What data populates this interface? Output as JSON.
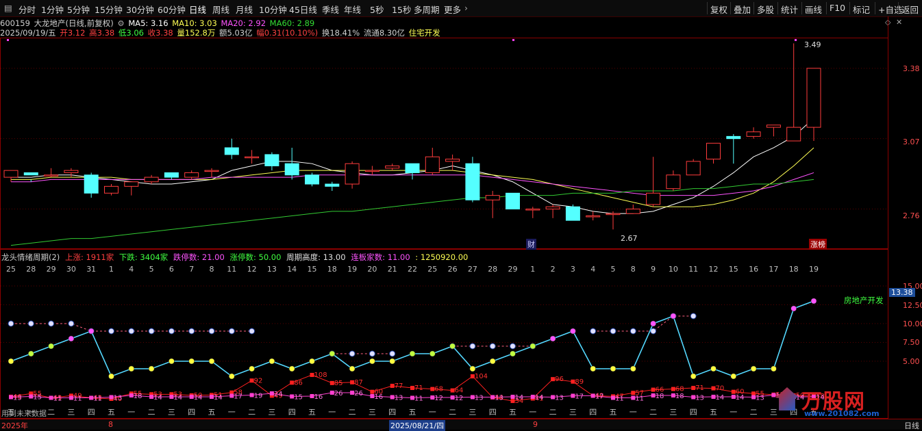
{
  "toolbar": {
    "left_items": [
      "分时",
      "1分钟",
      "5分钟",
      "15分钟",
      "30分钟",
      "60分钟",
      "日线",
      "周线",
      "月线",
      "10分钟",
      "45日线",
      "季线",
      "年线",
      "5秒",
      "15秒",
      "多周期",
      "更多"
    ],
    "active_item": "日线",
    "right_items": [
      "复权",
      "叠加",
      "多股",
      "统计",
      "画线",
      "F10",
      "标记",
      "+自选",
      "返回"
    ]
  },
  "stock": {
    "line1_code": "600159",
    "line1_name": "大龙地产(日线,前复权)",
    "ma5": "MA5: 3.16",
    "ma10": "MA10: 3.03",
    "ma20": "MA20: 2.92",
    "ma60": "MA60: 2.89",
    "date": "2025/09/19/五",
    "open": "开3.12",
    "high": "高3.38",
    "low": "低3.06",
    "close": "收3.38",
    "volume": "量152.8万",
    "amount": "额5.03亿",
    "change": "幅0.31(10.10%)",
    "turnover": "换18.41%",
    "float": "流通8.30亿",
    "sector": "住宅开发"
  },
  "price_axis": [
    "3.38",
    "3.07",
    "2.76"
  ],
  "price_annotations": {
    "high": "3.49",
    "low": "2.67",
    "tag_cai": "财",
    "tag_zhangbang": "涨榜"
  },
  "colors": {
    "up": "#ff3c3c",
    "down": "#54ffff",
    "ma5": "#ffffff",
    "ma10": "#ffff54",
    "ma20": "#ff54ff",
    "ma60": "#33cc33",
    "bg": "#000000",
    "grid": "#8b0000"
  },
  "chart_data": {
    "type": "candlestick",
    "candles": [
      [
        2.9,
        2.93,
        2.88,
        2.92
      ],
      [
        2.92,
        2.91,
        2.89,
        2.88
      ],
      [
        2.91,
        2.91,
        2.94,
        2.9
      ],
      [
        2.92,
        2.93,
        2.94,
        2.9
      ],
      [
        2.91,
        2.83,
        2.92,
        2.81
      ],
      [
        2.83,
        2.86,
        2.87,
        2.82
      ],
      [
        2.86,
        2.88,
        2.88,
        2.82
      ],
      [
        2.88,
        2.9,
        2.91,
        2.87
      ],
      [
        2.92,
        2.9,
        2.92,
        2.89
      ],
      [
        2.9,
        2.92,
        2.93,
        2.89
      ],
      [
        2.93,
        2.93,
        2.94,
        2.9
      ],
      [
        3.03,
        3.0,
        3.07,
        2.98
      ],
      [
        2.99,
        2.99,
        3.02,
        2.96
      ],
      [
        3.0,
        2.95,
        3.01,
        2.93
      ],
      [
        2.96,
        2.91,
        3.03,
        2.89
      ],
      [
        2.91,
        2.87,
        2.92,
        2.86
      ],
      [
        2.87,
        2.86,
        2.88,
        2.84
      ],
      [
        2.87,
        2.96,
        2.97,
        2.85
      ],
      [
        2.93,
        2.93,
        2.95,
        2.91
      ],
      [
        2.94,
        2.95,
        2.96,
        2.93
      ],
      [
        2.96,
        2.92,
        2.96,
        2.89
      ],
      [
        2.92,
        2.99,
        3.03,
        2.91
      ],
      [
        2.97,
        2.98,
        3.0,
        2.93
      ],
      [
        2.96,
        2.8,
        2.99,
        2.79
      ],
      [
        2.8,
        2.82,
        2.84,
        2.72
      ],
      [
        2.83,
        2.76,
        2.83,
        2.76
      ],
      [
        2.76,
        2.76,
        2.77,
        2.72
      ],
      [
        2.76,
        2.77,
        2.78,
        2.72
      ],
      [
        2.77,
        2.71,
        2.78,
        2.71
      ],
      [
        2.73,
        2.73,
        2.75,
        2.71
      ],
      [
        2.74,
        2.74,
        2.75,
        2.67
      ],
      [
        2.74,
        2.76,
        2.78,
        2.74
      ],
      [
        2.78,
        2.83,
        2.99,
        2.77
      ],
      [
        2.85,
        2.91,
        2.93,
        2.84
      ],
      [
        2.91,
        2.97,
        2.98,
        2.91
      ],
      [
        2.98,
        3.05,
        3.05,
        2.96
      ],
      [
        3.08,
        3.07,
        3.09,
        2.96
      ],
      [
        3.08,
        3.1,
        3.12,
        3.07
      ],
      [
        3.12,
        3.13,
        3.13,
        3.08
      ],
      [
        3.06,
        3.12,
        3.49,
        3.06
      ],
      [
        3.12,
        3.38,
        3.38,
        3.06
      ]
    ],
    "ma_series": [
      {
        "name": "MA5",
        "values": [
          2.9,
          2.9,
          2.91,
          2.91,
          2.9,
          2.89,
          2.88,
          2.87,
          2.87,
          2.88,
          2.89,
          2.93,
          2.95,
          2.97,
          2.97,
          2.96,
          2.93,
          2.92,
          2.91,
          2.91,
          2.92,
          2.93,
          2.95,
          2.93,
          2.91,
          2.88,
          2.83,
          2.78,
          2.77,
          2.75,
          2.74,
          2.74,
          2.75,
          2.78,
          2.81,
          2.86,
          2.92,
          2.99,
          3.03,
          3.08,
          3.16
        ]
      },
      {
        "name": "MA10",
        "values": [
          2.89,
          2.89,
          2.9,
          2.9,
          2.9,
          2.9,
          2.89,
          2.89,
          2.89,
          2.89,
          2.89,
          2.9,
          2.91,
          2.92,
          2.93,
          2.93,
          2.93,
          2.93,
          2.93,
          2.93,
          2.93,
          2.93,
          2.93,
          2.92,
          2.91,
          2.9,
          2.89,
          2.87,
          2.85,
          2.83,
          2.81,
          2.79,
          2.77,
          2.77,
          2.77,
          2.78,
          2.8,
          2.83,
          2.88,
          2.95,
          3.03
        ]
      },
      {
        "name": "MA20",
        "values": [
          2.88,
          2.88,
          2.89,
          2.89,
          2.89,
          2.89,
          2.89,
          2.89,
          2.89,
          2.89,
          2.9,
          2.9,
          2.9,
          2.9,
          2.9,
          2.91,
          2.91,
          2.91,
          2.91,
          2.91,
          2.91,
          2.91,
          2.91,
          2.91,
          2.9,
          2.89,
          2.88,
          2.87,
          2.86,
          2.85,
          2.84,
          2.83,
          2.82,
          2.82,
          2.82,
          2.82,
          2.83,
          2.84,
          2.86,
          2.89,
          2.92
        ]
      },
      {
        "name": "MA60",
        "values": [
          2.6,
          2.61,
          2.62,
          2.63,
          2.63,
          2.64,
          2.65,
          2.66,
          2.67,
          2.68,
          2.69,
          2.7,
          2.71,
          2.72,
          2.73,
          2.74,
          2.75,
          2.75,
          2.76,
          2.77,
          2.78,
          2.79,
          2.8,
          2.81,
          2.81,
          2.82,
          2.82,
          2.82,
          2.83,
          2.83,
          2.83,
          2.84,
          2.84,
          2.84,
          2.85,
          2.85,
          2.86,
          2.87,
          2.87,
          2.88,
          2.89
        ]
      }
    ],
    "ylim": [
      2.62,
      3.5
    ]
  },
  "indicator": {
    "title": "龙头情绪周期(2)",
    "up": "上涨: 1911家",
    "down": "下跌: 3404家",
    "limit_down": "跌停数: 21.00",
    "limit_up": "涨停数: 50.00",
    "cycle_height": "周期高度: 13.00",
    "consec": "连板家数: 11.00",
    "extra": ": 1250920.00",
    "axis": [
      "15.00",
      "12.50",
      "10.00",
      "7.50",
      "5.00"
    ],
    "current_value": "13.38",
    "sector_label": "房地产开发",
    "top_labels": [
      "25",
      "28",
      "29",
      "30",
      "31",
      "1",
      "4",
      "5",
      "6",
      "7",
      "8",
      "11",
      "12",
      "13",
      "14",
      "15",
      "18",
      "19",
      "20",
      "21",
      "22",
      "25",
      "26",
      "27",
      "28",
      "29",
      "1",
      "2",
      "3",
      "4",
      "5",
      "8",
      "9",
      "10",
      "11",
      "12",
      "15",
      "16",
      "17",
      "18",
      "19"
    ],
    "bottom_labels": [
      "五",
      "一",
      "二",
      "三",
      "四",
      "五",
      "一",
      "二",
      "三",
      "四",
      "五",
      "一",
      "二",
      "三",
      "四",
      "五",
      "一",
      "二",
      "三",
      "四",
      "五",
      "一",
      "二",
      "三",
      "四",
      "五",
      "一",
      "二",
      "三",
      "四",
      "五",
      "一",
      "二",
      "三",
      "四",
      "五",
      "一",
      "二",
      "三",
      "四",
      "五"
    ],
    "cycle_values": [
      5,
      6,
      7,
      8,
      9,
      3,
      4,
      4,
      5,
      5,
      5,
      3,
      4,
      5,
      4,
      5,
      6,
      4,
      5,
      5,
      6,
      6,
      7,
      4,
      5,
      6,
      7,
      8,
      9,
      4,
      4,
      4,
      10,
      11,
      3,
      4,
      3,
      4,
      4,
      12,
      13
    ],
    "dashed_values": [
      10,
      10,
      10,
      10,
      9,
      9,
      9,
      9,
      9,
      9,
      9,
      9,
      9,
      null,
      null,
      null,
      6,
      6,
      6,
      6,
      null,
      null,
      7,
      7,
      7,
      7,
      7,
      null,
      null,
      9,
      9,
      9,
      9,
      11,
      11,
      null,
      null,
      null,
      null,
      null,
      null
    ],
    "red_values": [
      46,
      55,
      43,
      49,
      43,
      40,
      55,
      53,
      53,
      50,
      51,
      58,
      92,
      49,
      86,
      108,
      85,
      87,
      60,
      77,
      71,
      68,
      64,
      104,
      44,
      34,
      41,
      96,
      89,
      49,
      47,
      57,
      66,
      68,
      71,
      70,
      60,
      55,
      52,
      50,
      48
    ],
    "pink_values": [
      13,
      15,
      11,
      11,
      11,
      13,
      18,
      14,
      14,
      14,
      14,
      17,
      19,
      24,
      15,
      16,
      26,
      26,
      16,
      13,
      11,
      12,
      12,
      13,
      13,
      14,
      14,
      13,
      17,
      17,
      11,
      11,
      18,
      18,
      13,
      14,
      14,
      13,
      19,
      14,
      14
    ],
    "xaxis_year": "2025年",
    "xaxis_aug": "8",
    "xaxis_cursor": "2025/08/21/四",
    "xaxis_sep": "9",
    "period_label": "日线",
    "future_label": "用到未来数据"
  },
  "watermark": {
    "text": "万股网",
    "url": "www.201082.com"
  }
}
